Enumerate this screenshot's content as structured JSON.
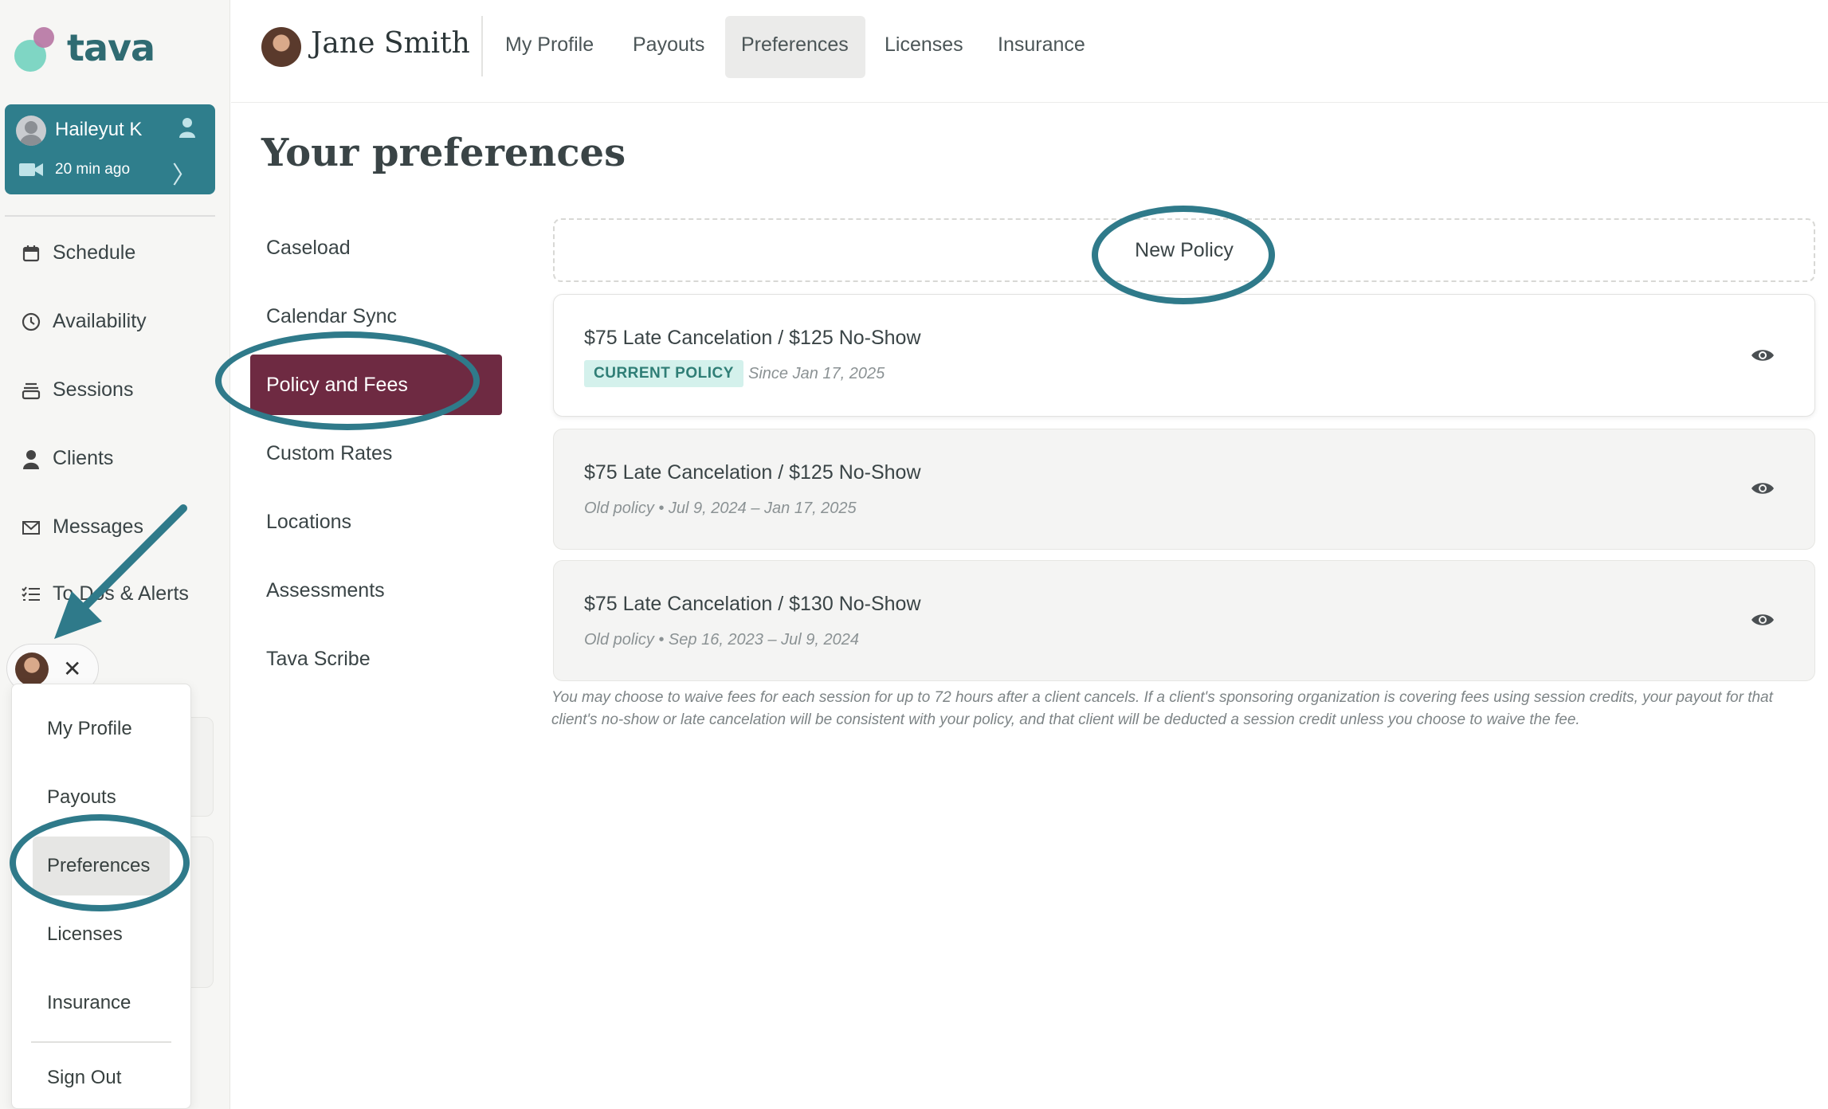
{
  "brand": {
    "logo_text": "tava",
    "accent": "#2f7e8c",
    "active_nav": "#6e2a42",
    "annotation": "#2f7a8a"
  },
  "session": {
    "client_name": "Haileyut K",
    "time": "20 min ago"
  },
  "sidebar": {
    "items": [
      {
        "label": "Schedule",
        "icon": "calendar-icon"
      },
      {
        "label": "Availability",
        "icon": "clock-icon"
      },
      {
        "label": "Sessions",
        "icon": "stack-icon"
      },
      {
        "label": "Clients",
        "icon": "person-icon"
      },
      {
        "label": "Messages",
        "icon": "envelope-icon"
      },
      {
        "label": "To Dos & Alerts",
        "icon": "checklist-icon"
      }
    ]
  },
  "profile_menu": {
    "items": [
      "My Profile",
      "Payouts",
      "Preferences",
      "Licenses",
      "Insurance"
    ],
    "sign_out": "Sign Out",
    "selected": "Preferences"
  },
  "topbar": {
    "user_name": "Jane Smith",
    "tabs": [
      "My Profile",
      "Payouts",
      "Preferences",
      "Licenses",
      "Insurance"
    ],
    "active_tab": "Preferences"
  },
  "page": {
    "title": "Your preferences",
    "subnav": [
      "Caseload",
      "Calendar Sync",
      "Policy and Fees",
      "Custom Rates",
      "Locations",
      "Assessments",
      "Tava Scribe"
    ],
    "active_subnav": "Policy and Fees"
  },
  "policies": {
    "new_label": "New Policy",
    "current": {
      "title": "$75 Late Cancelation / $125 No-Show",
      "badge": "CURRENT POLICY",
      "since": "Since Jan 17, 2025"
    },
    "old": [
      {
        "title": "$75 Late Cancelation / $125 No-Show",
        "meta": "Old policy • Jul 9, 2024 – Jan 17, 2025"
      },
      {
        "title": "$75 Late Cancelation / $130 No-Show",
        "meta": "Old policy • Sep 16, 2023 – Jul 9, 2024"
      }
    ],
    "footnote": "You may choose to waive fees for each session for up to 72 hours after a client cancels. If a client's sponsoring organization is covering fees using session credits, your payout for that client's no-show or late cancelation will be consistent with your policy, and that client will be deducted a session credit unless you choose to waive the fee."
  }
}
